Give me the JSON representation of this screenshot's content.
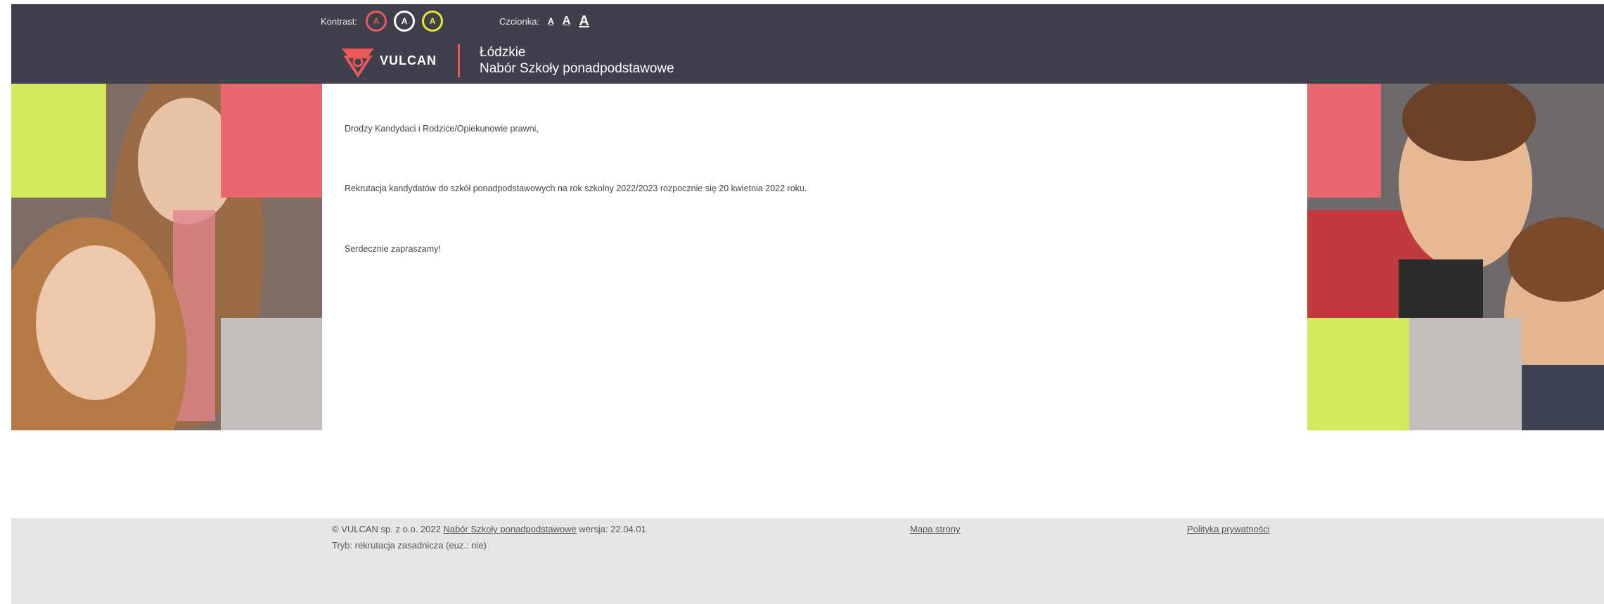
{
  "accessibility": {
    "contrast_label": "Kontrast:",
    "contrast_buttons": [
      {
        "label": "A",
        "color": "#e85a5a",
        "name": "default"
      },
      {
        "label": "A",
        "color": "#ffffff",
        "name": "black-white"
      },
      {
        "label": "A",
        "color": "#e6e62e",
        "name": "yellow"
      }
    ],
    "font_label": "Czcionka:",
    "font_buttons": [
      "A",
      "A",
      "A"
    ]
  },
  "brand": {
    "logo_text": "VULCAN",
    "region": "Łódzkie",
    "system_name": "Nabór Szkoły ponadpodstawowe"
  },
  "content": {
    "greeting": "Drodzy Kandydaci i Rodzice/Opiekunowie prawni,",
    "message": "Rekrutacja kandydatów do szkół ponadpodstawowych na rok szkolny 2022/2023 rozpocznie się 20 kwietnia 2022 roku.",
    "closing": "Serdecznie zapraszamy!"
  },
  "footer": {
    "copyright": "© VULCAN sp. z o.o. 2022",
    "product_link": "Nabór Szkoły ponadpodstawowe",
    "version": "wersja: 22.04.01",
    "mode": "Tryb: rekrutacja zasadnicza (euz.: nie)",
    "sitemap": "Mapa strony",
    "privacy": "Polityka prywatności"
  },
  "colors": {
    "header_bg": "#40404c",
    "accent_red": "#e85a5a",
    "accent_green": "#d4e85c",
    "accent_gray": "#c4bfbd",
    "footer_bg": "#e6e6e6"
  }
}
